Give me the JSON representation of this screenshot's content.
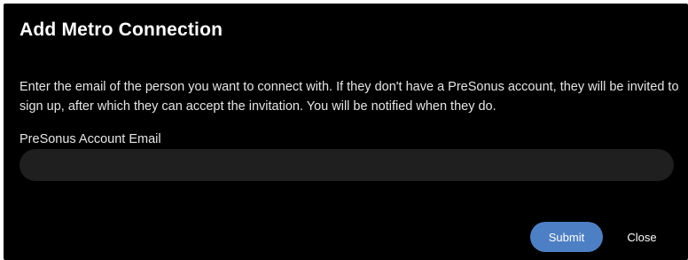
{
  "dialog": {
    "title": "Add Metro Connection",
    "description": "Enter the email of the person you want to connect with. If they don't have a PreSonus account, they will be invited to sign up, after which they can accept the invitation. You will be notified when they do.",
    "email_field": {
      "label": "PreSonus Account Email",
      "value": "",
      "placeholder": ""
    },
    "buttons": {
      "submit_label": "Submit",
      "close_label": "Close"
    }
  },
  "colors": {
    "background": "#000000",
    "input_background": "#1f1f1f",
    "accent": "#4d7fc4",
    "text": "#ffffff"
  }
}
